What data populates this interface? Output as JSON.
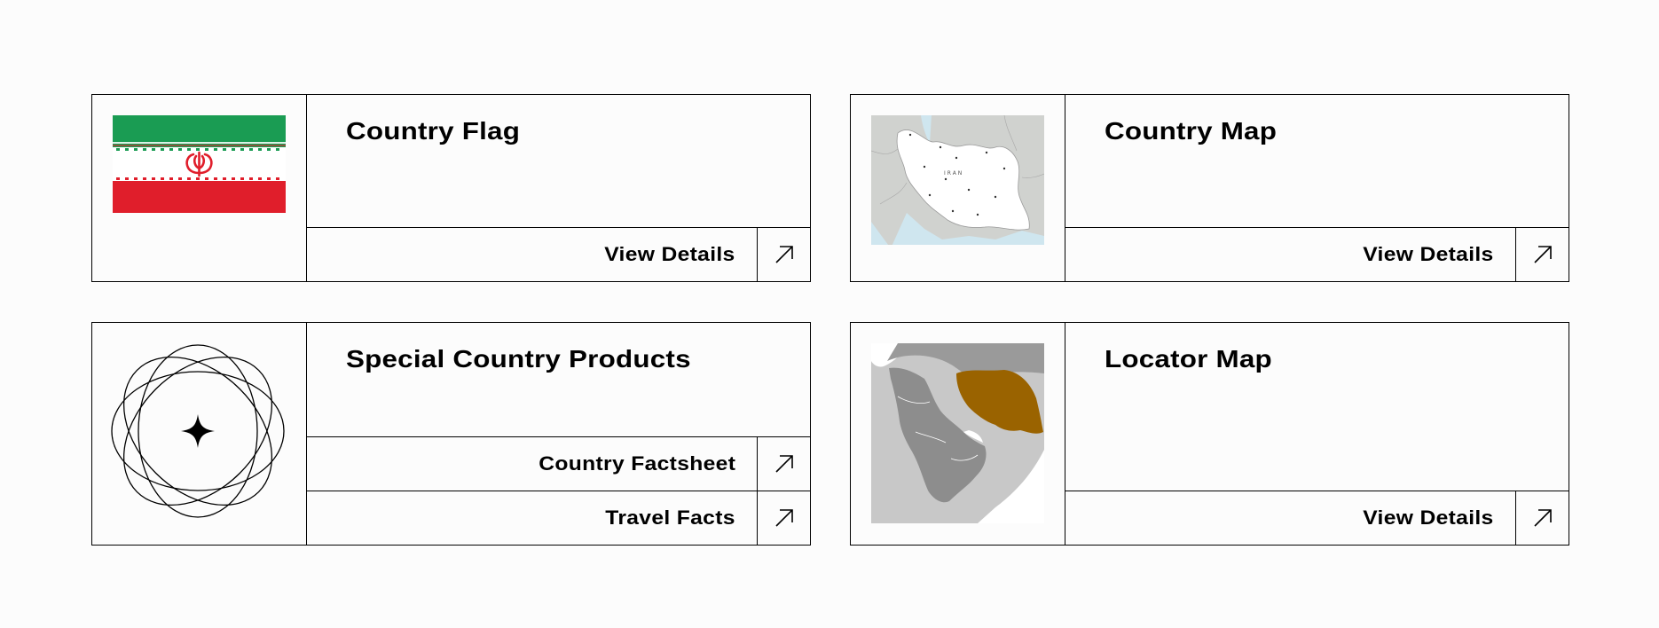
{
  "cards": [
    {
      "title": "Country Flag",
      "media_icon": "flag-of-iran",
      "links": [
        {
          "label": "View Details",
          "icon": "arrow-up-right-icon"
        }
      ]
    },
    {
      "title": "Country Map",
      "media_icon": "map-of-iran",
      "map_labels": {
        "country": "IRAN"
      },
      "links": [
        {
          "label": "View Details",
          "icon": "arrow-up-right-icon"
        }
      ]
    },
    {
      "title": "Special Country Products",
      "media_icon": "orbit-sparkle-icon",
      "links": [
        {
          "label": "Country Factsheet",
          "icon": "arrow-up-right-icon"
        },
        {
          "label": "Travel Facts",
          "icon": "arrow-up-right-icon"
        }
      ]
    },
    {
      "title": "Locator Map",
      "media_icon": "locator-map-middle-east",
      "links": [
        {
          "label": "View Details",
          "icon": "arrow-up-right-icon"
        }
      ]
    }
  ],
  "colors": {
    "flag_green": "#1a9c53",
    "flag_red": "#e01e2b",
    "highlight": "#9a6300",
    "land_dark": "#8d8d8d",
    "land_light": "#c8c8c8",
    "water": "#cfe6ef"
  }
}
